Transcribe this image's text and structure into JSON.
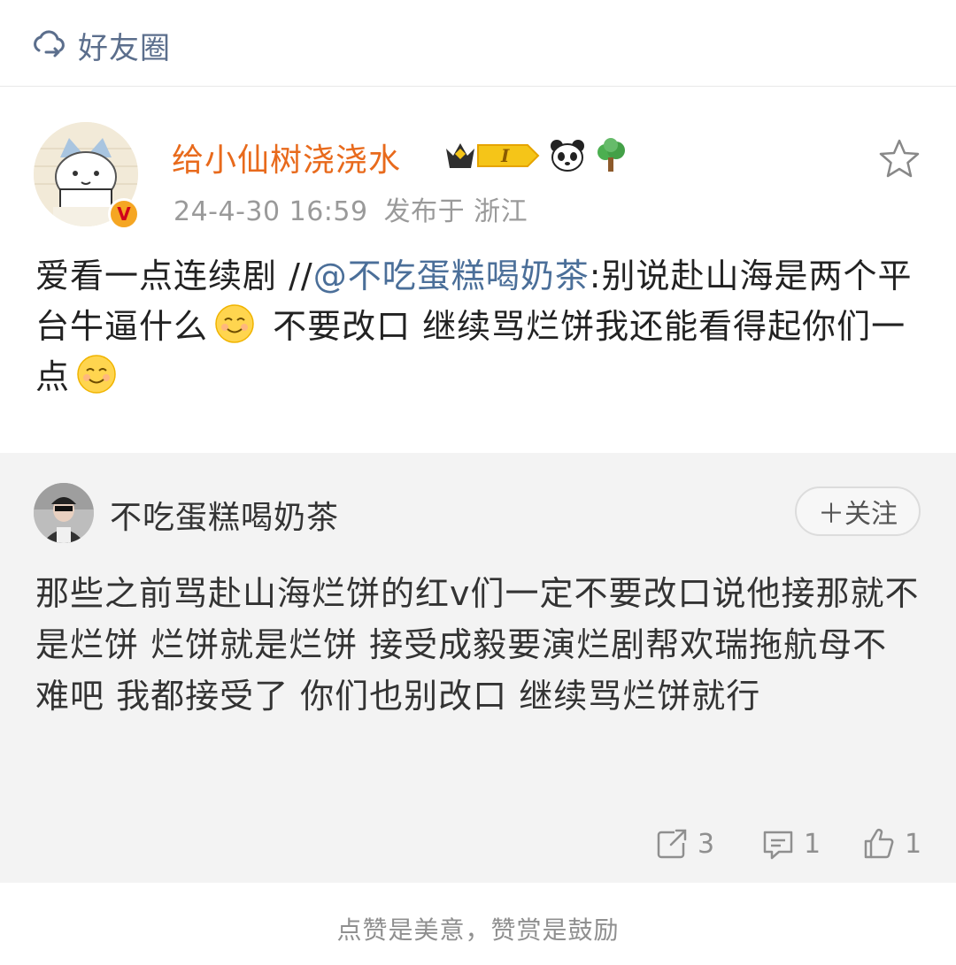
{
  "topbar": {
    "label": "好友圈"
  },
  "post": {
    "username": "给小仙树浇浇水",
    "level_badge": "I",
    "timestamp": "24-4-30 16:59",
    "location": "发布于 浙江",
    "text_intro": "爱看一点连续剧 //",
    "mention": "@不吃蛋糕喝奶茶",
    "text_part1": ":别说赴山海是两个平台牛逼什么",
    "text_part2": " 不要改口 继续骂烂饼我还能看得起你们一点"
  },
  "quote": {
    "username": "不吃蛋糕喝奶茶",
    "follow_label": "＋关注",
    "text": "那些之前骂赴山海烂饼的红v们一定不要改口说他接那就不是烂饼 烂饼就是烂饼 接受成毅要演烂剧帮欢瑞拖航母不难吧 我都接受了 你们也别改口 继续骂烂饼就行",
    "repost_count": "3",
    "comment_count": "1",
    "like_count": "1"
  },
  "footer": {
    "text": "点赞是美意，赞赏是鼓励"
  },
  "colors": {
    "username": "#e86a1c",
    "mention": "#4b6f99",
    "quote_bg": "#f3f3f3"
  }
}
